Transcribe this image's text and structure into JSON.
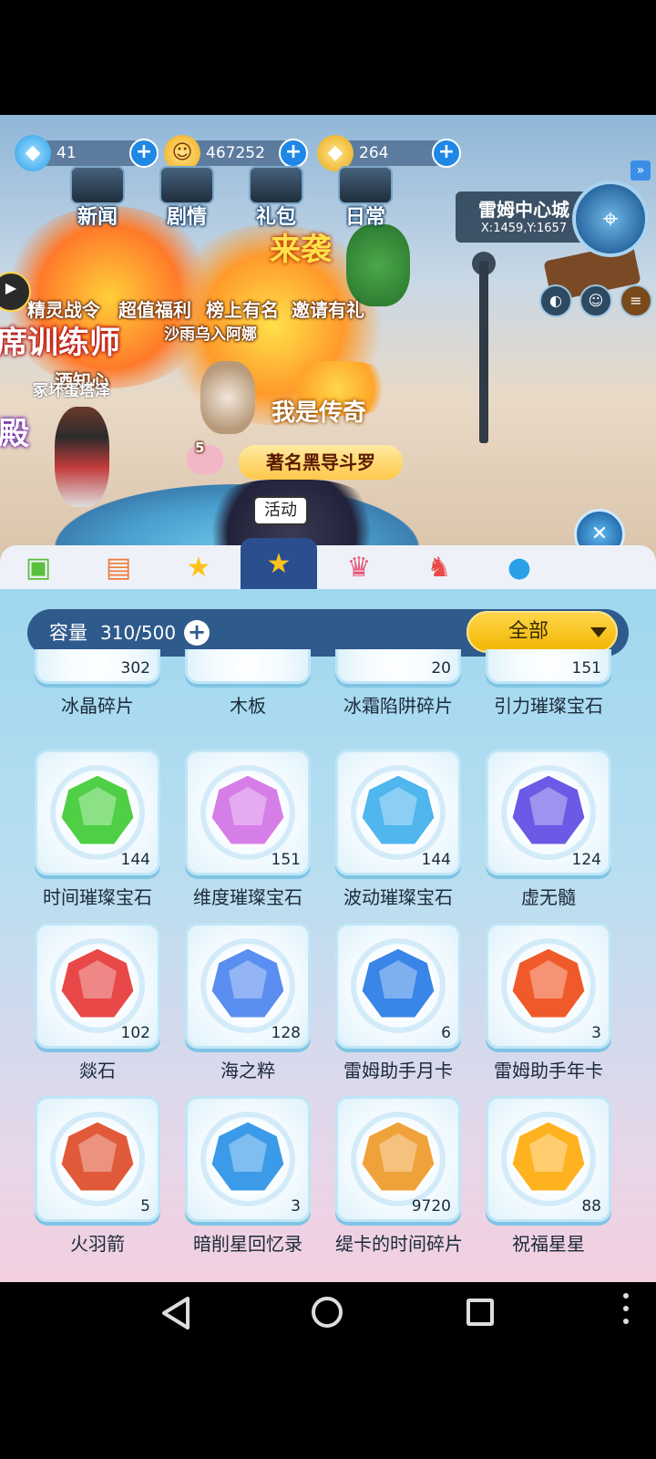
{
  "resources": [
    {
      "icon": "diamond-icon",
      "value": "41"
    },
    {
      "icon": "cat-coin-icon",
      "value": "467252"
    },
    {
      "icon": "gold-gem-icon",
      "value": "264"
    }
  ],
  "top_menu": [
    "新闻",
    "剧情",
    "礼包",
    "日常"
  ],
  "event_menu": [
    "精灵战令",
    "超值福利",
    "榜上有名",
    "邀请有礼"
  ],
  "location": {
    "city": "雷姆中心城",
    "coord": "X:1459,Y:1657"
  },
  "scene_text": {
    "player_name_1": "酒知心",
    "player_title": "我是传奇",
    "player_name_2": "著名黑导斗罗",
    "pet_level": "5",
    "banner_1": "席训练师",
    "banner_2": "殿",
    "banner_3": "来袭",
    "small_text_1": "沙雨乌入阿娜",
    "small_text_2": "冢坏蛋塔泽"
  },
  "tooltip": "活动",
  "tabs": [
    {
      "icon": "battery-icon"
    },
    {
      "icon": "boxes-icon"
    },
    {
      "icon": "star-wand-icon"
    },
    {
      "icon": "star-chest-icon",
      "active": true
    },
    {
      "icon": "dress-icon"
    },
    {
      "icon": "rocking-horse-icon"
    },
    {
      "icon": "egg-icon"
    }
  ],
  "capacity": {
    "label": "容量",
    "value": "310/500"
  },
  "filter": {
    "label": "全部"
  },
  "items": [
    {
      "name": "冰晶碎片",
      "count": "302"
    },
    {
      "name": "木板",
      "count": ""
    },
    {
      "name": "冰霜陷阱碎片",
      "count": "20"
    },
    {
      "name": "引力璀璨宝石",
      "count": "151"
    },
    {
      "name": "时间璀璨宝石",
      "count": "144",
      "color": "#4fcf46"
    },
    {
      "name": "维度璀璨宝石",
      "count": "151",
      "color": "#d67ee8"
    },
    {
      "name": "波动璀璨宝石",
      "count": "144",
      "color": "#4fb6ee"
    },
    {
      "name": "虚无髓",
      "count": "124",
      "color": "#6a5ae6"
    },
    {
      "name": "燚石",
      "count": "102",
      "color": "#e84848"
    },
    {
      "name": "海之粹",
      "count": "128",
      "color": "#5a8ef0"
    },
    {
      "name": "雷姆助手月卡",
      "count": "6",
      "color": "#3a86e8"
    },
    {
      "name": "雷姆助手年卡",
      "count": "3",
      "color": "#f05a2a"
    },
    {
      "name": "火羽箭",
      "count": "5",
      "color": "#e05a3a"
    },
    {
      "name": "暗削星回忆录",
      "count": "3",
      "color": "#3b9be8"
    },
    {
      "name": "缇卡的时间碎片",
      "count": "9720",
      "color": "#f0a23a"
    },
    {
      "name": "祝福星星",
      "count": "88",
      "color": "#ffb21f"
    }
  ]
}
